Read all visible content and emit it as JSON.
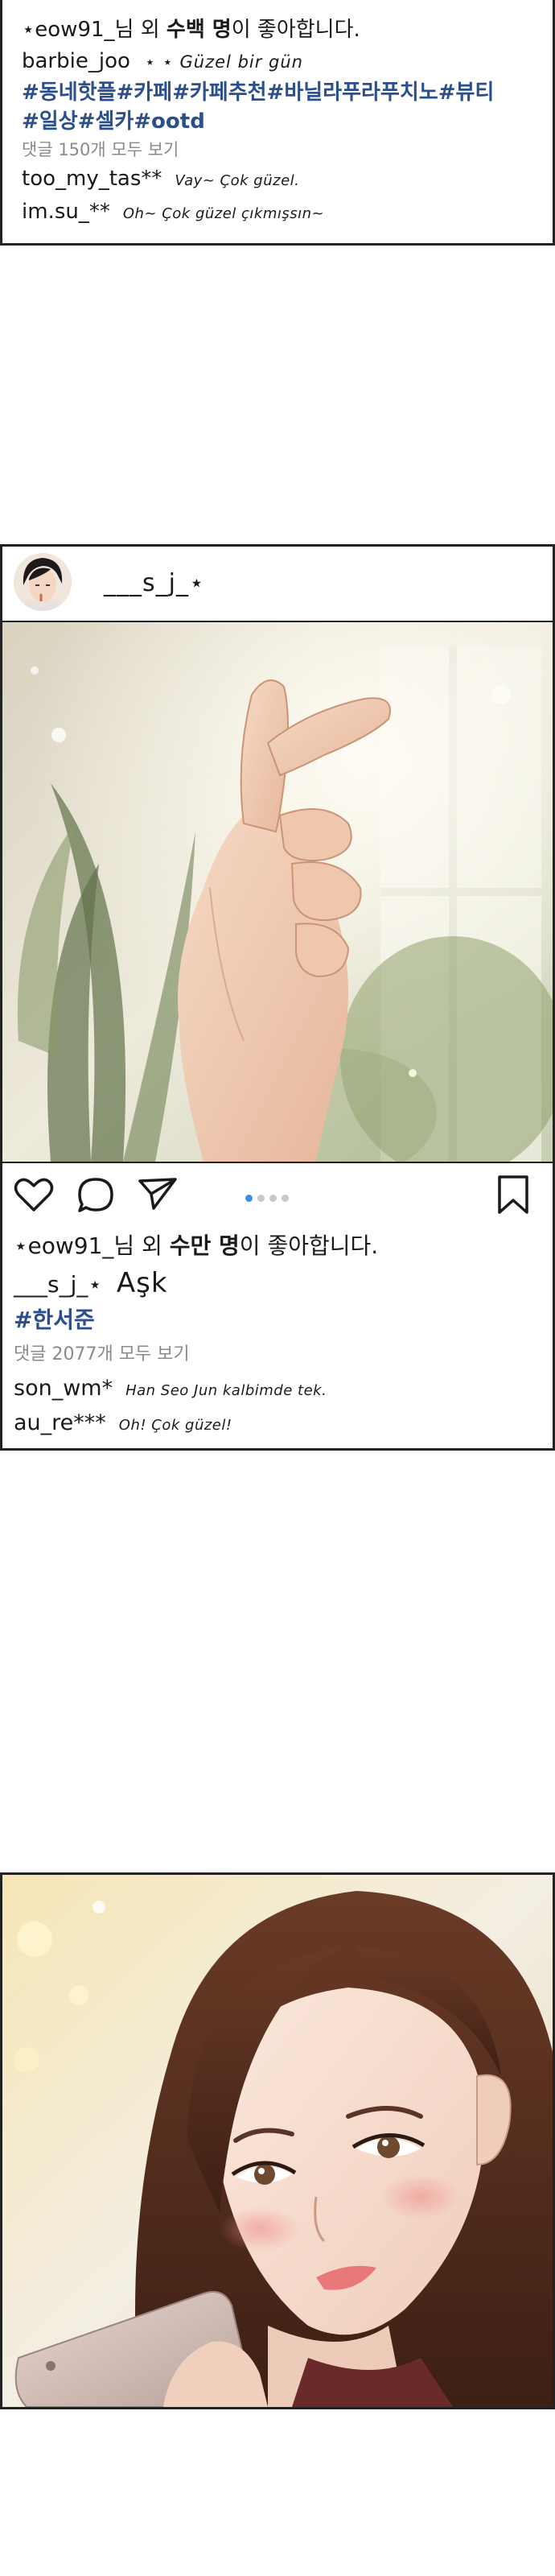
{
  "post1": {
    "likes": {
      "prefix": "⋆eow91_",
      "mid": "님 외 ",
      "bold": "수백 명",
      "suffix": "이 좋아합니다."
    },
    "caption": {
      "user": "barbie_joo",
      "text": "⋆ ⋆ Güzel bir gün"
    },
    "hashtags": [
      "#동네핫플#카페#카페추천#바닐라푸라푸치노#뷰티",
      "#일상#셀카#ootd"
    ],
    "comment_count": "댓글 150개 모두 보기",
    "comments": [
      {
        "user": "too_my_tas**",
        "text": "Vay~ Çok güzel."
      },
      {
        "user": "im.su_**",
        "text": "Oh~ Çok güzel çıkmışsın~"
      }
    ]
  },
  "post2": {
    "username": "___s_j_⋆",
    "likes": {
      "prefix": "⋆eow91_",
      "mid": "님 외 ",
      "bold": "수만 명",
      "suffix": "이 좋아합니다."
    },
    "caption": {
      "user": "___s_j_⋆",
      "text": "Aşk"
    },
    "hashtags": [
      "#한서준"
    ],
    "comment_count": "댓글 2077개 모두 보기",
    "comments": [
      {
        "user": "son_wm*",
        "text": "Han Seo Jun kalbimde tek."
      },
      {
        "user": "au_re***",
        "text": "Oh! Çok güzel!"
      }
    ],
    "carousel": {
      "total": 4,
      "active_index": 0
    }
  },
  "icons": {
    "like": "heart-icon",
    "comment": "comment-bubble-icon",
    "share": "send-icon",
    "save": "bookmark-icon"
  },
  "colors": {
    "hashtag": "#2b4f8c",
    "muted": "#8a8a8a",
    "carousel_active": "#3d8fe0",
    "carousel_inactive": "#c8c8c8",
    "border": "#222222"
  }
}
